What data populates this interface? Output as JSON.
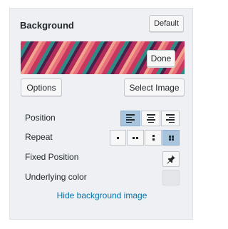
{
  "header": {
    "title": "Background",
    "default_label": "Default"
  },
  "preview": {
    "done_label": "Done",
    "stripe_colors": [
      "#2f8a87",
      "#c8385e",
      "#e9717c",
      "#f2a58e",
      "#b22a59",
      "#4b1f47"
    ]
  },
  "actions": {
    "options_label": "Options",
    "select_image_label": "Select Image"
  },
  "settings": {
    "position_label": "Position",
    "repeat_label": "Repeat",
    "fixed_position_label": "Fixed Position",
    "underlying_color_label": "Underlying color",
    "position_selected": "left",
    "repeat_selected": "tile",
    "accent_color": "#a8c3dc",
    "underlying_color": "#e4e6e9"
  },
  "hide_link": "Hide background image"
}
